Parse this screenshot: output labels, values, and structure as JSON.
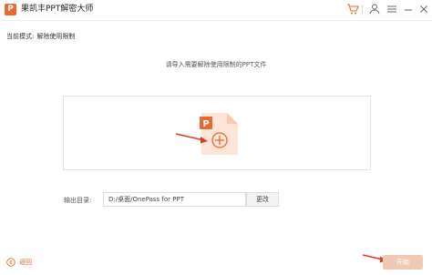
{
  "window": {
    "logo_letter": "P",
    "title": "果凯丰PPT解密大师"
  },
  "titlebar_icons": [
    "cart-icon",
    "user-icon",
    "menu-icon",
    "minimize-icon",
    "close-icon"
  ],
  "mode": {
    "label": "当前模式:",
    "value": "解除使用限制"
  },
  "main": {
    "prompt": "请导入需要解除使用限制的PPT文件",
    "file_icon_letter": "P"
  },
  "output": {
    "label": "输出目录:",
    "path": "D:/桌面/OnePass for PPT",
    "change_label": "更改"
  },
  "footer": {
    "back_label": "返回",
    "start_label": "开始"
  },
  "colors": {
    "accent": "#e86a2e",
    "arrow": "#e03a2a",
    "start_disabled": "#f0c9b5"
  }
}
